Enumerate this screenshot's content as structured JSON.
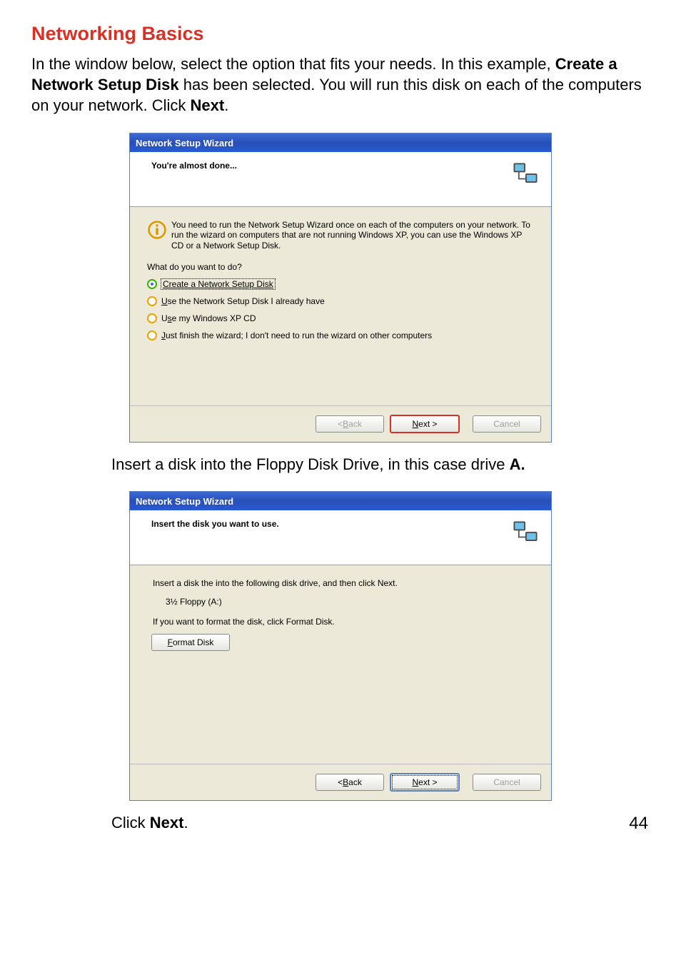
{
  "section_title": "Networking Basics",
  "intro": {
    "part1": "In the window below, select the option that fits your needs. In this example, ",
    "bold1": "Create a Network Setup Disk",
    "part2": " has been selected.  You will run this disk on each of the computers on your network. Click ",
    "bold2": "Next",
    "part3": "."
  },
  "wizard1": {
    "title": "Network Setup Wizard",
    "heading": "You're almost done...",
    "info": "You need to run the Network Setup Wizard once on each of the computers on your network. To run the wizard on computers that are not running Windows XP, you can use the Windows XP CD or a Network Setup Disk.",
    "question": "What do you want to do?",
    "options": [
      "Create a Network Setup Disk",
      "Use the Network Setup Disk I already have",
      "Use my Windows XP CD",
      "Just finish the wizard; I don't need to run the wizard on other computers"
    ],
    "back": "< Back",
    "next": "Next >",
    "cancel": "Cancel"
  },
  "midtext": {
    "part1": "Insert a disk into the Floppy Disk Drive, in this case drive ",
    "bold": "A."
  },
  "wizard2": {
    "title": "Network Setup Wizard",
    "heading": "Insert the disk you want to use.",
    "line1": "Insert a disk the into the following disk drive, and then click Next.",
    "drive": "3½ Floppy (A:)",
    "line2": "If you want to format the disk, click Format Disk.",
    "format_btn": "Format Disk",
    "back": "< Back",
    "next": "Next >",
    "cancel": "Cancel"
  },
  "closing": {
    "part1": "Click ",
    "bold": "Next",
    "part2": "."
  },
  "page_number": "44"
}
